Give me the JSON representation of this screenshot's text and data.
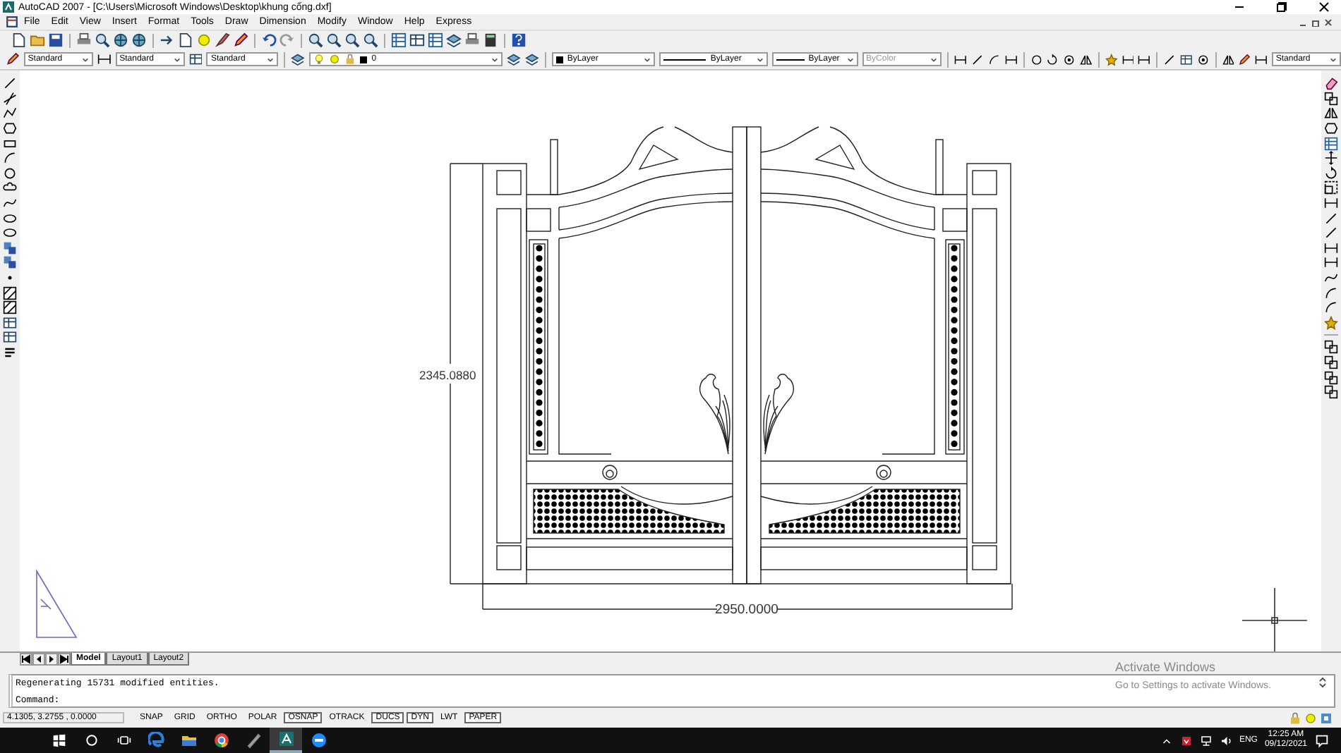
{
  "window": {
    "title": "AutoCAD 2007 - [C:\\Users\\Microsoft Windows\\Desktop\\khung cổng.dxf]"
  },
  "menu": [
    "File",
    "Edit",
    "View",
    "Insert",
    "Format",
    "Tools",
    "Draw",
    "Dimension",
    "Modify",
    "Window",
    "Help",
    "Express"
  ],
  "styles_toolbar": {
    "text_style": "Standard",
    "dimension_style": "Standard",
    "table_style": "Standard",
    "multileader_style": "Standard"
  },
  "properties_toolbar": {
    "layer": "0",
    "color_control": "ByLayer",
    "linetype": "ByLayer",
    "lineweight": "ByLayer",
    "plot_style": {
      "value": "ByColor",
      "disabled": true
    }
  },
  "drawing": {
    "vertical_dimension": "2345.0880",
    "horizontal_dimension": "2950.0000"
  },
  "layout_tabs": [
    {
      "label": "Model",
      "selected": true
    },
    {
      "label": "Layout1",
      "selected": false
    },
    {
      "label": "Layout2",
      "selected": false
    }
  ],
  "command_line": {
    "history": [
      "Regenerating 15731 modified entities."
    ],
    "prompt": "Command:"
  },
  "status_bar": {
    "coordinates": "4.1305, 3.2755 , 0.0000",
    "toggles": [
      {
        "label": "SNAP",
        "on": false
      },
      {
        "label": "GRID",
        "on": false
      },
      {
        "label": "ORTHO",
        "on": false
      },
      {
        "label": "POLAR",
        "on": false
      },
      {
        "label": "OSNAP",
        "on": true
      },
      {
        "label": "OTRACK",
        "on": false
      },
      {
        "label": "DUCS",
        "on": true
      },
      {
        "label": "DYN",
        "on": true
      },
      {
        "label": "LWT",
        "on": false
      },
      {
        "label": "PAPER",
        "on": true
      }
    ]
  },
  "activation_notice": {
    "title": "Activate Windows",
    "message": "Go to Settings to activate Windows."
  },
  "taskbar": {
    "apps": [
      {
        "kind": "edge",
        "selected": false
      },
      {
        "kind": "explorer",
        "selected": false
      },
      {
        "kind": "chrome",
        "selected": false
      },
      {
        "kind": "pen",
        "selected": false
      },
      {
        "kind": "autocad",
        "selected": true
      },
      {
        "kind": "zalo",
        "selected": false
      }
    ],
    "language": "ENG",
    "time": "12:25 AM",
    "date": "09/12/2021"
  }
}
